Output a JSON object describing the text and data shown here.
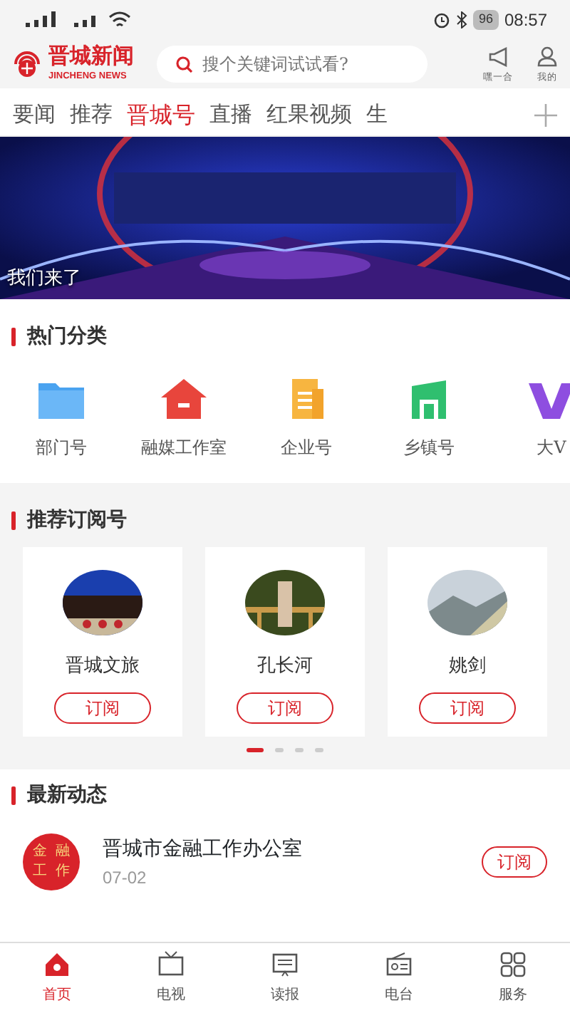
{
  "status_bar": {
    "battery": "96",
    "time": "08:57"
  },
  "header": {
    "logo_title": "晋城新闻",
    "logo_subtitle": "JINCHENG NEWS",
    "search": {
      "placeholder": "搜个关键词试试看?"
    },
    "actions": [
      {
        "kind": "shout",
        "label": "嘿一合"
      },
      {
        "kind": "user",
        "label": "我的"
      }
    ]
  },
  "tabs": [
    {
      "label": "要闻",
      "selected": false
    },
    {
      "label": "推荐",
      "selected": false
    },
    {
      "label": "晋城号",
      "selected": true
    },
    {
      "label": "直播",
      "selected": false
    },
    {
      "label": "红果视频",
      "selected": false
    },
    {
      "label": "生",
      "selected": false
    }
  ],
  "banner": {
    "caption": "我们来了"
  },
  "hot_categories": {
    "title": "热门分类",
    "items": [
      {
        "kind": "folder",
        "label": "部门号"
      },
      {
        "kind": "house",
        "label": "融媒工作室"
      },
      {
        "kind": "doc",
        "label": "企业号"
      },
      {
        "kind": "town",
        "label": "乡镇号"
      },
      {
        "kind": "v",
        "label": "大V"
      }
    ]
  },
  "recommended": {
    "title": "推荐订阅号",
    "cards": [
      {
        "name": "晋城文旅",
        "button": "订阅"
      },
      {
        "name": "孔长河",
        "button": "订阅"
      },
      {
        "name": "姚剑",
        "button": "订阅"
      }
    ],
    "pager": [
      {
        "selected": true
      },
      {
        "selected": false
      },
      {
        "selected": false
      },
      {
        "selected": false
      }
    ]
  },
  "latest": {
    "title": "最新动态",
    "items": [
      {
        "avatar": [
          "金",
          "融",
          "工",
          "作"
        ],
        "name": "晋城市金融工作办公室",
        "date": "07-02",
        "button": "订阅"
      }
    ]
  },
  "bottom_nav": [
    {
      "kind": "home",
      "label": "首页",
      "selected": true
    },
    {
      "kind": "tv",
      "label": "电视",
      "selected": false
    },
    {
      "kind": "paper",
      "label": "读报",
      "selected": false
    },
    {
      "kind": "radio",
      "label": "电台",
      "selected": false
    },
    {
      "kind": "grid",
      "label": "服务",
      "selected": false
    }
  ]
}
